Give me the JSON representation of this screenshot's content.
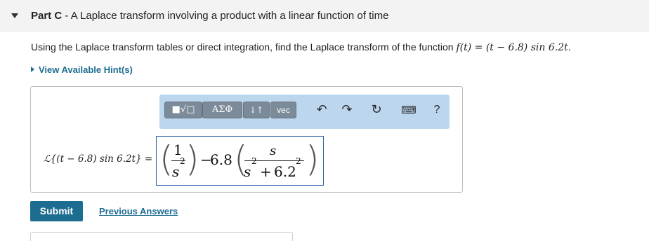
{
  "part": {
    "label": "Part C",
    "separator": " - ",
    "title": "A Laplace transform involving a product with a linear function of time"
  },
  "question": {
    "text": "Using the Laplace transform tables or direct integration, find the Laplace transform of the function ",
    "function": "f(t) = (t − 6.8) sin 6.2t",
    "end": "."
  },
  "hint": {
    "label": "View Available Hint(s)"
  },
  "toolbar": {
    "templates_label": "■√□",
    "symbols_label": "ΑΣΦ",
    "arrows_label": "↓↑",
    "vec_label": "vec",
    "icons": [
      "undo-icon",
      "redo-icon",
      "reset-icon",
      "keyboard-icon",
      "help-icon"
    ],
    "help_label": "?"
  },
  "answer": {
    "lhs": "ℒ{(t − 6.8) sin 6.2t} =",
    "term1_numerator": "1",
    "term1_denominator": "s",
    "term1_exponent": "2",
    "minus": "−",
    "coefficient": "6.8",
    "term2_numerator": "s",
    "term2_denominator_s": "s",
    "term2_exponent1": "2",
    "term2_plus": "+",
    "term2_constant": "6.2",
    "term2_exponent2": "2"
  },
  "actions": {
    "submit_label": "Submit",
    "previous_answers_label": "Previous Answers"
  },
  "colors": {
    "link": "#1d6d91",
    "submit": "#1d6d91",
    "toolbar": "#bcd6ee",
    "toolbar_button": "#7c8b9a",
    "input_border": "#2b5ea8"
  }
}
